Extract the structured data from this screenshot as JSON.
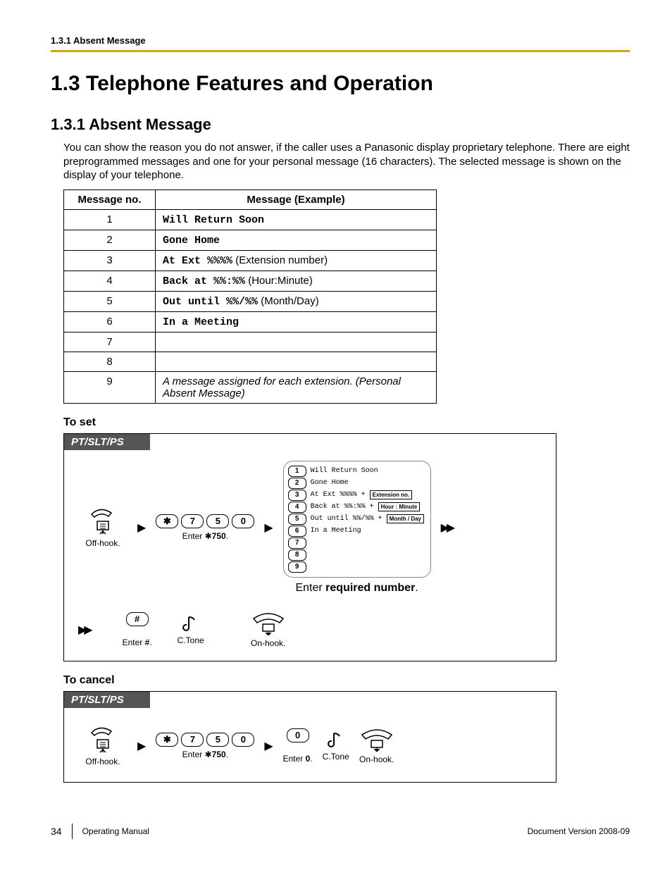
{
  "header": {
    "running": "1.3.1 Absent Message"
  },
  "section": {
    "title": "1.3  Telephone Features and Operation",
    "sub": "1.3.1  Absent Message",
    "intro": "You can show the reason you do not answer, if the caller uses a Panasonic display proprietary telephone. There are eight preprogrammed messages and one for your personal message (16 characters). The selected message is shown on the display of your telephone."
  },
  "table": {
    "head_no": "Message no.",
    "head_ex": "Message (Example)",
    "rows": [
      {
        "no": "1",
        "bold": "Will Return Soon",
        "plain": ""
      },
      {
        "no": "2",
        "bold": "Gone Home",
        "plain": ""
      },
      {
        "no": "3",
        "bold": "At Ext %%%%",
        "plain": " (Extension number)"
      },
      {
        "no": "4",
        "bold": "Back at %%:%%",
        "plain": " (Hour:Minute)"
      },
      {
        "no": "5",
        "bold": "Out until %%/%%",
        "plain": " (Month/Day)"
      },
      {
        "no": "6",
        "bold": "In a Meeting",
        "plain": ""
      },
      {
        "no": "7",
        "bold": "",
        "plain": ""
      },
      {
        "no": "8",
        "bold": "",
        "plain": ""
      },
      {
        "no": "9",
        "bold": "",
        "plain": "",
        "italic": "A message assigned for each extension. (Personal Absent Message)"
      }
    ]
  },
  "proc_set": {
    "label": "To set",
    "band": "PT/SLT/PS",
    "offhook": "Off-hook.",
    "enter750_pre": "Enter ",
    "enter750_code": "750",
    "enter750_post": ".",
    "keys": [
      "7",
      "5",
      "0"
    ],
    "msglist": [
      {
        "k": "1",
        "t": "Will Return Soon"
      },
      {
        "k": "2",
        "t": "Gone Home"
      },
      {
        "k": "3",
        "t": "At Ext %%%% +",
        "p": "Extension no."
      },
      {
        "k": "4",
        "t": "Back at %%:%% +",
        "p": "Hour : Minute"
      },
      {
        "k": "5",
        "t": "Out until %%/%% +",
        "p": "Month / Day"
      },
      {
        "k": "6",
        "t": "In a Meeting"
      },
      {
        "k": "7",
        "t": ""
      },
      {
        "k": "8",
        "t": ""
      },
      {
        "k": "9",
        "t": ""
      }
    ],
    "enter_req_pre": "Enter ",
    "enter_req_bold": "required number",
    "enter_req_post": ".",
    "hash": "#",
    "enter_hash_pre": "Enter ",
    "enter_hash_bold": "#",
    "enter_hash_post": ".",
    "ctone": "C.Tone",
    "onhook": "On-hook."
  },
  "proc_cancel": {
    "label": "To cancel",
    "band": "PT/SLT/PS",
    "offhook": "Off-hook.",
    "enter750_pre": "Enter ",
    "enter750_code": "750",
    "enter750_post": ".",
    "keys": [
      "7",
      "5",
      "0"
    ],
    "zero": "0",
    "enter0_pre": "Enter ",
    "enter0_bold": "0",
    "enter0_post": ".",
    "ctone": "C.Tone",
    "onhook": "On-hook."
  },
  "footer": {
    "page": "34",
    "manual": "Operating Manual",
    "docver": "Document Version  2008-09"
  }
}
